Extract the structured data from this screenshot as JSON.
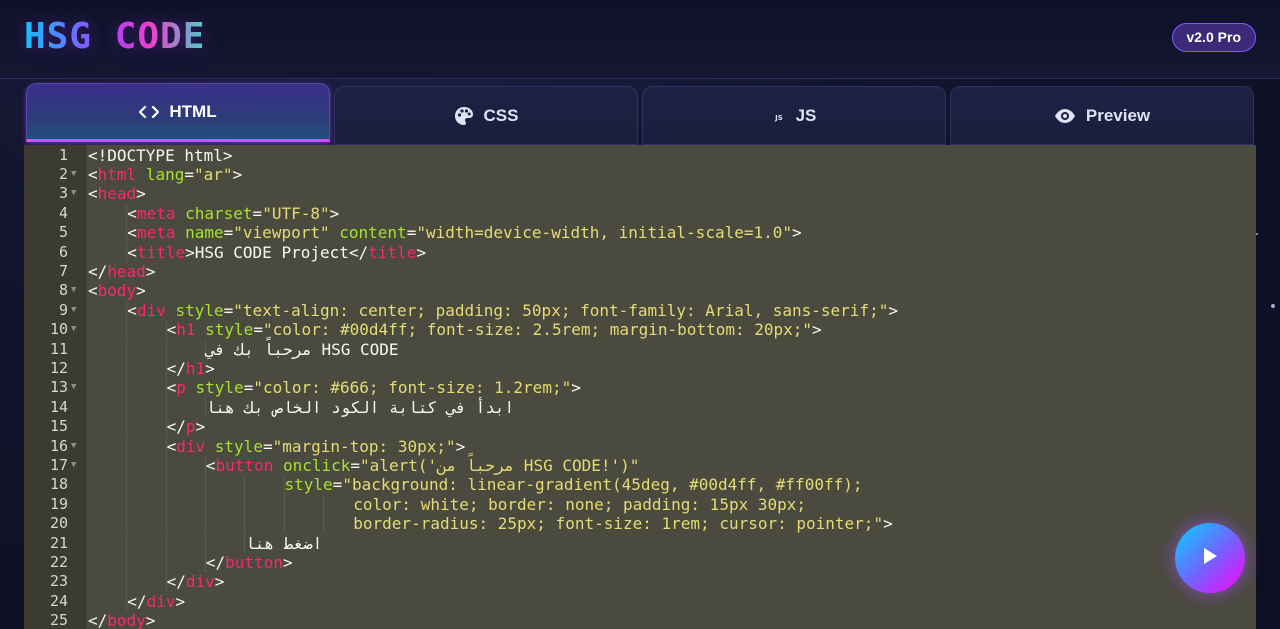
{
  "app": {
    "logo": "HSG CODE",
    "version": "v2.0 Pro"
  },
  "tabs": [
    {
      "label": "HTML",
      "icon": "code-icon",
      "active": true
    },
    {
      "label": "CSS",
      "icon": "palette-icon",
      "active": false
    },
    {
      "label": "JS",
      "icon": "js-icon",
      "active": false
    },
    {
      "label": "Preview",
      "icon": "eye-icon",
      "active": false
    }
  ],
  "editor": {
    "theme_colors": {
      "background": "#4a4a3e",
      "tag": "#f92672",
      "attribute": "#a6e22e",
      "string": "#e6db74",
      "text": "#f8f8f2"
    },
    "lines": [
      {
        "n": "1",
        "fold": false,
        "indent": 0,
        "tokens": [
          [
            "p",
            "<!DOCTYPE html>"
          ]
        ]
      },
      {
        "n": "2",
        "fold": true,
        "indent": 0,
        "tokens": [
          [
            "p",
            "<"
          ],
          [
            "t",
            "html"
          ],
          [
            "p",
            " "
          ],
          [
            "a",
            "lang"
          ],
          [
            "p",
            "="
          ],
          [
            "s",
            "\"ar\""
          ],
          [
            "p",
            ">"
          ]
        ]
      },
      {
        "n": "3",
        "fold": true,
        "indent": 0,
        "tokens": [
          [
            "p",
            "<"
          ],
          [
            "t",
            "head"
          ],
          [
            "p",
            ">"
          ]
        ]
      },
      {
        "n": "4",
        "fold": false,
        "indent": 1,
        "tokens": [
          [
            "p",
            "<"
          ],
          [
            "t",
            "meta"
          ],
          [
            "p",
            " "
          ],
          [
            "a",
            "charset"
          ],
          [
            "p",
            "="
          ],
          [
            "s",
            "\"UTF-8\""
          ],
          [
            "p",
            ">"
          ]
        ]
      },
      {
        "n": "5",
        "fold": false,
        "indent": 1,
        "tokens": [
          [
            "p",
            "<"
          ],
          [
            "t",
            "meta"
          ],
          [
            "p",
            " "
          ],
          [
            "a",
            "name"
          ],
          [
            "p",
            "="
          ],
          [
            "s",
            "\"viewport\""
          ],
          [
            "p",
            " "
          ],
          [
            "a",
            "content"
          ],
          [
            "p",
            "="
          ],
          [
            "s",
            "\"width=device-width, initial-scale=1.0\""
          ],
          [
            "p",
            ">"
          ]
        ]
      },
      {
        "n": "6",
        "fold": false,
        "indent": 1,
        "tokens": [
          [
            "p",
            "<"
          ],
          [
            "t",
            "title"
          ],
          [
            "p",
            ">HSG CODE Project</"
          ],
          [
            "t",
            "title"
          ],
          [
            "p",
            ">"
          ]
        ]
      },
      {
        "n": "7",
        "fold": false,
        "indent": 0,
        "tokens": [
          [
            "p",
            "</"
          ],
          [
            "t",
            "head"
          ],
          [
            "p",
            ">"
          ]
        ]
      },
      {
        "n": "8",
        "fold": true,
        "indent": 0,
        "tokens": [
          [
            "p",
            "<"
          ],
          [
            "t",
            "body"
          ],
          [
            "p",
            ">"
          ]
        ]
      },
      {
        "n": "9",
        "fold": true,
        "indent": 1,
        "tokens": [
          [
            "p",
            "<"
          ],
          [
            "t",
            "div"
          ],
          [
            "p",
            " "
          ],
          [
            "a",
            "style"
          ],
          [
            "p",
            "="
          ],
          [
            "s",
            "\"text-align: center; padding: 50px; font-family: Arial, sans-serif;\""
          ],
          [
            "p",
            ">"
          ]
        ]
      },
      {
        "n": "10",
        "fold": true,
        "indent": 2,
        "tokens": [
          [
            "p",
            "<"
          ],
          [
            "t",
            "h1"
          ],
          [
            "p",
            " "
          ],
          [
            "a",
            "style"
          ],
          [
            "p",
            "="
          ],
          [
            "s",
            "\"color: #00d4ff; font-size: 2.5rem; margin-bottom: 20px;\""
          ],
          [
            "p",
            ">"
          ]
        ]
      },
      {
        "n": "11",
        "fold": false,
        "indent": 3,
        "tokens": [
          [
            "p",
            "مرحباً بك في HSG CODE"
          ]
        ]
      },
      {
        "n": "12",
        "fold": false,
        "indent": 2,
        "tokens": [
          [
            "p",
            "</"
          ],
          [
            "t",
            "h1"
          ],
          [
            "p",
            ">"
          ]
        ]
      },
      {
        "n": "13",
        "fold": true,
        "indent": 2,
        "tokens": [
          [
            "p",
            "<"
          ],
          [
            "t",
            "p"
          ],
          [
            "p",
            " "
          ],
          [
            "a",
            "style"
          ],
          [
            "p",
            "="
          ],
          [
            "s",
            "\"color: #666; font-size: 1.2rem;\""
          ],
          [
            "p",
            ">"
          ]
        ]
      },
      {
        "n": "14",
        "fold": false,
        "indent": 3,
        "tokens": [
          [
            "p",
            "ابدأ في كتابة الكود الخاص بك هنا"
          ]
        ]
      },
      {
        "n": "15",
        "fold": false,
        "indent": 2,
        "tokens": [
          [
            "p",
            "</"
          ],
          [
            "t",
            "p"
          ],
          [
            "p",
            ">"
          ]
        ]
      },
      {
        "n": "16",
        "fold": true,
        "indent": 2,
        "tokens": [
          [
            "p",
            "<"
          ],
          [
            "t",
            "div"
          ],
          [
            "p",
            " "
          ],
          [
            "a",
            "style"
          ],
          [
            "p",
            "="
          ],
          [
            "s",
            "\"margin-top: 30px;\""
          ],
          [
            "p",
            ">"
          ]
        ]
      },
      {
        "n": "17",
        "fold": true,
        "indent": 3,
        "tokens": [
          [
            "p",
            "<"
          ],
          [
            "t",
            "button"
          ],
          [
            "p",
            " "
          ],
          [
            "a",
            "onclick"
          ],
          [
            "p",
            "="
          ],
          [
            "s",
            "\"alert('مرحباً من HSG CODE!')\""
          ]
        ]
      },
      {
        "n": "18",
        "fold": false,
        "indent": 5,
        "tokens": [
          [
            "a",
            "style"
          ],
          [
            "p",
            "="
          ],
          [
            "s",
            "\"background: linear-gradient(45deg, #00d4ff, #ff00ff);"
          ]
        ]
      },
      {
        "n": "19",
        "fold": false,
        "indent": 6.75,
        "tokens": [
          [
            "s",
            "color: white; border: none; padding: 15px 30px;"
          ]
        ]
      },
      {
        "n": "20",
        "fold": false,
        "indent": 6.75,
        "tokens": [
          [
            "s",
            "border-radius: 25px; font-size: 1rem; cursor: pointer;\""
          ],
          [
            "p",
            ">"
          ]
        ]
      },
      {
        "n": "21",
        "fold": false,
        "indent": 4,
        "tokens": [
          [
            "p",
            "اضغط هنا"
          ]
        ]
      },
      {
        "n": "22",
        "fold": false,
        "indent": 3,
        "tokens": [
          [
            "p",
            "</"
          ],
          [
            "t",
            "button"
          ],
          [
            "p",
            ">"
          ]
        ]
      },
      {
        "n": "23",
        "fold": false,
        "indent": 2,
        "tokens": [
          [
            "p",
            "</"
          ],
          [
            "t",
            "div"
          ],
          [
            "p",
            ">"
          ]
        ]
      },
      {
        "n": "24",
        "fold": false,
        "indent": 1,
        "tokens": [
          [
            "p",
            "</"
          ],
          [
            "t",
            "div"
          ],
          [
            "p",
            ">"
          ]
        ]
      },
      {
        "n": "25",
        "fold": false,
        "indent": 0,
        "tokens": [
          [
            "p",
            "</"
          ],
          [
            "t",
            "body"
          ],
          [
            "p",
            ">"
          ]
        ]
      }
    ]
  },
  "run_button": {
    "icon": "play-icon"
  },
  "colors": {
    "accent": "#7a5cff",
    "brand_cyan": "#00d4ff",
    "brand_magenta": "#ff00ff"
  }
}
